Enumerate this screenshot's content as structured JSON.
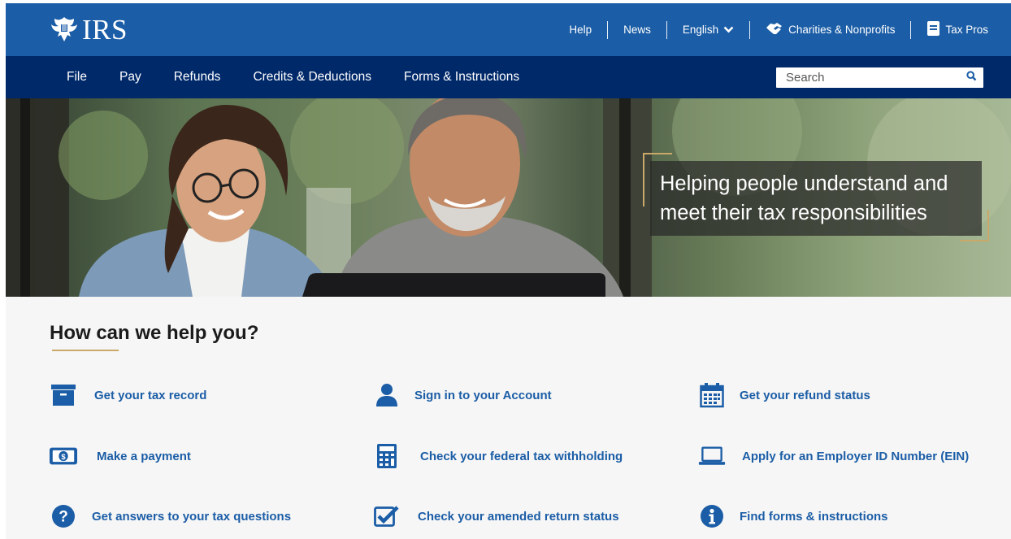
{
  "brand": {
    "logo_text": "IRS"
  },
  "utility_nav": {
    "help": "Help",
    "news": "News",
    "language": "English",
    "charities": "Charities & Nonprofits",
    "tax_pros": "Tax Pros"
  },
  "main_nav": {
    "items": [
      "File",
      "Pay",
      "Refunds",
      "Credits & Deductions",
      "Forms & Instructions"
    ],
    "search_placeholder": "Search"
  },
  "hero": {
    "caption_line1": "Helping people understand and",
    "caption_line2": "meet their tax responsibilities"
  },
  "help": {
    "title": "How can we help you?",
    "links": [
      {
        "label": "Get your tax record",
        "icon": "archive-box-icon"
      },
      {
        "label": "Sign in to your Account",
        "icon": "person-icon"
      },
      {
        "label": "Get your refund status",
        "icon": "calendar-icon"
      },
      {
        "label": "Make a payment",
        "icon": "dollar-bill-icon"
      },
      {
        "label": "Check your federal tax withholding",
        "icon": "calculator-icon"
      },
      {
        "label": "Apply for an Employer ID Number (EIN)",
        "icon": "laptop-icon"
      },
      {
        "label": "Get answers to your tax questions",
        "icon": "question-circle-icon"
      },
      {
        "label": "Check your amended return status",
        "icon": "checkbox-icon"
      },
      {
        "label": "Find forms & instructions",
        "icon": "info-circle-icon"
      }
    ]
  },
  "colors": {
    "header_blue": "#1b5da6",
    "nav_navy": "#00296a",
    "link_blue": "#1b5da6",
    "accent_gold": "#c9a86a",
    "page_bg": "#f6f6f6"
  }
}
